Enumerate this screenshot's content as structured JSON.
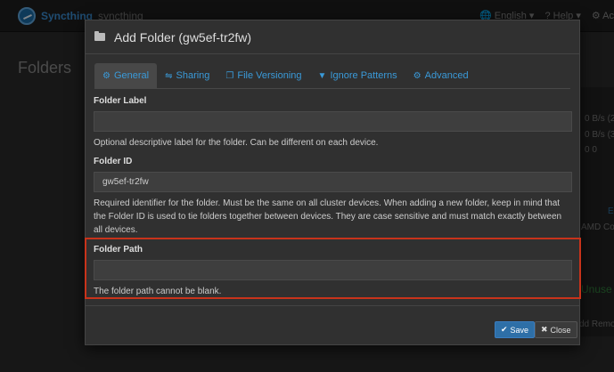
{
  "navbar": {
    "brand": "Syncthing",
    "device_name": "syncthing",
    "language": "English",
    "help": "Help",
    "actions": "Ac"
  },
  "page": {
    "heading": "Folders"
  },
  "background_panel": {
    "stats": [
      "0 B/s (2",
      "0 B/s (3",
      "0   0",
      "E",
      "AMD Co",
      "Unuse",
      "dd Remot"
    ]
  },
  "modal": {
    "title": "Add Folder (gw5ef-tr2fw)",
    "tabs": [
      {
        "label": "General",
        "icon": "gear-icon",
        "glyph": "⚙"
      },
      {
        "label": "Sharing",
        "icon": "share-icon",
        "glyph": "⇋"
      },
      {
        "label": "File Versioning",
        "icon": "copy-icon",
        "glyph": "❐"
      },
      {
        "label": "Ignore Patterns",
        "icon": "filter-icon",
        "glyph": "▼"
      },
      {
        "label": "Advanced",
        "icon": "cogs-icon",
        "glyph": "⚙"
      }
    ],
    "folder_label": {
      "label": "Folder Label",
      "value": "",
      "help": "Optional descriptive label for the folder. Can be different on each device."
    },
    "folder_id": {
      "label": "Folder ID",
      "value": "gw5ef-tr2fw",
      "help": "Required identifier for the folder. Must be the same on all cluster devices. When adding a new folder, keep in mind that the Folder ID is used to tie folders together between devices. They are case sensitive and must match exactly between all devices."
    },
    "folder_path": {
      "label": "Folder Path",
      "value": "",
      "error": "The folder path cannot be blank."
    },
    "buttons": {
      "save": "Save",
      "close": "Close"
    }
  },
  "colors": {
    "accent": "#3a9ad9",
    "error": "#c8331b",
    "primary_button": "#2e6fa7"
  }
}
